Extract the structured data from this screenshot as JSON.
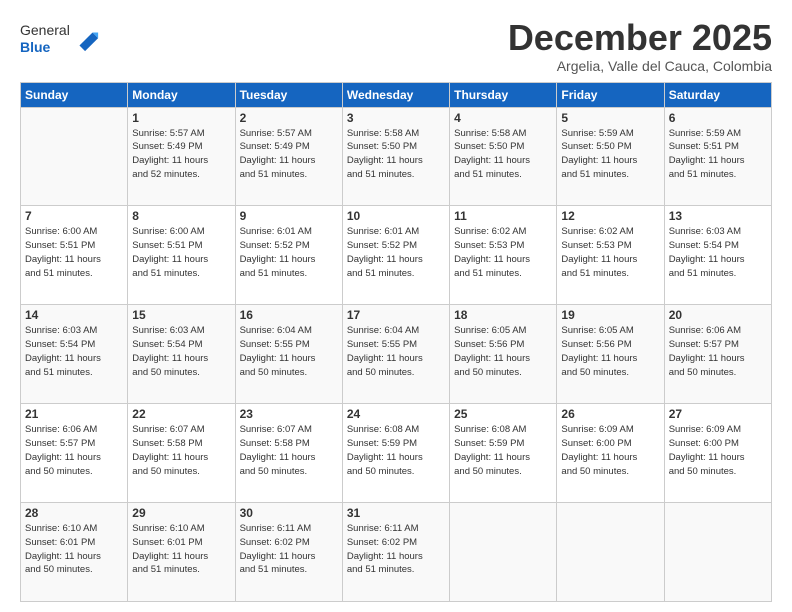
{
  "header": {
    "logo_general": "General",
    "logo_blue": "Blue",
    "month_title": "December 2025",
    "location": "Argelia, Valle del Cauca, Colombia"
  },
  "weekdays": [
    "Sunday",
    "Monday",
    "Tuesday",
    "Wednesday",
    "Thursday",
    "Friday",
    "Saturday"
  ],
  "weeks": [
    [
      {
        "day": "",
        "info": ""
      },
      {
        "day": "1",
        "info": "Sunrise: 5:57 AM\nSunset: 5:49 PM\nDaylight: 11 hours\nand 52 minutes."
      },
      {
        "day": "2",
        "info": "Sunrise: 5:57 AM\nSunset: 5:49 PM\nDaylight: 11 hours\nand 51 minutes."
      },
      {
        "day": "3",
        "info": "Sunrise: 5:58 AM\nSunset: 5:50 PM\nDaylight: 11 hours\nand 51 minutes."
      },
      {
        "day": "4",
        "info": "Sunrise: 5:58 AM\nSunset: 5:50 PM\nDaylight: 11 hours\nand 51 minutes."
      },
      {
        "day": "5",
        "info": "Sunrise: 5:59 AM\nSunset: 5:50 PM\nDaylight: 11 hours\nand 51 minutes."
      },
      {
        "day": "6",
        "info": "Sunrise: 5:59 AM\nSunset: 5:51 PM\nDaylight: 11 hours\nand 51 minutes."
      }
    ],
    [
      {
        "day": "7",
        "info": "Sunrise: 6:00 AM\nSunset: 5:51 PM\nDaylight: 11 hours\nand 51 minutes."
      },
      {
        "day": "8",
        "info": "Sunrise: 6:00 AM\nSunset: 5:51 PM\nDaylight: 11 hours\nand 51 minutes."
      },
      {
        "day": "9",
        "info": "Sunrise: 6:01 AM\nSunset: 5:52 PM\nDaylight: 11 hours\nand 51 minutes."
      },
      {
        "day": "10",
        "info": "Sunrise: 6:01 AM\nSunset: 5:52 PM\nDaylight: 11 hours\nand 51 minutes."
      },
      {
        "day": "11",
        "info": "Sunrise: 6:02 AM\nSunset: 5:53 PM\nDaylight: 11 hours\nand 51 minutes."
      },
      {
        "day": "12",
        "info": "Sunrise: 6:02 AM\nSunset: 5:53 PM\nDaylight: 11 hours\nand 51 minutes."
      },
      {
        "day": "13",
        "info": "Sunrise: 6:03 AM\nSunset: 5:54 PM\nDaylight: 11 hours\nand 51 minutes."
      }
    ],
    [
      {
        "day": "14",
        "info": "Sunrise: 6:03 AM\nSunset: 5:54 PM\nDaylight: 11 hours\nand 51 minutes."
      },
      {
        "day": "15",
        "info": "Sunrise: 6:03 AM\nSunset: 5:54 PM\nDaylight: 11 hours\nand 50 minutes."
      },
      {
        "day": "16",
        "info": "Sunrise: 6:04 AM\nSunset: 5:55 PM\nDaylight: 11 hours\nand 50 minutes."
      },
      {
        "day": "17",
        "info": "Sunrise: 6:04 AM\nSunset: 5:55 PM\nDaylight: 11 hours\nand 50 minutes."
      },
      {
        "day": "18",
        "info": "Sunrise: 6:05 AM\nSunset: 5:56 PM\nDaylight: 11 hours\nand 50 minutes."
      },
      {
        "day": "19",
        "info": "Sunrise: 6:05 AM\nSunset: 5:56 PM\nDaylight: 11 hours\nand 50 minutes."
      },
      {
        "day": "20",
        "info": "Sunrise: 6:06 AM\nSunset: 5:57 PM\nDaylight: 11 hours\nand 50 minutes."
      }
    ],
    [
      {
        "day": "21",
        "info": "Sunrise: 6:06 AM\nSunset: 5:57 PM\nDaylight: 11 hours\nand 50 minutes."
      },
      {
        "day": "22",
        "info": "Sunrise: 6:07 AM\nSunset: 5:58 PM\nDaylight: 11 hours\nand 50 minutes."
      },
      {
        "day": "23",
        "info": "Sunrise: 6:07 AM\nSunset: 5:58 PM\nDaylight: 11 hours\nand 50 minutes."
      },
      {
        "day": "24",
        "info": "Sunrise: 6:08 AM\nSunset: 5:59 PM\nDaylight: 11 hours\nand 50 minutes."
      },
      {
        "day": "25",
        "info": "Sunrise: 6:08 AM\nSunset: 5:59 PM\nDaylight: 11 hours\nand 50 minutes."
      },
      {
        "day": "26",
        "info": "Sunrise: 6:09 AM\nSunset: 6:00 PM\nDaylight: 11 hours\nand 50 minutes."
      },
      {
        "day": "27",
        "info": "Sunrise: 6:09 AM\nSunset: 6:00 PM\nDaylight: 11 hours\nand 50 minutes."
      }
    ],
    [
      {
        "day": "28",
        "info": "Sunrise: 6:10 AM\nSunset: 6:01 PM\nDaylight: 11 hours\nand 50 minutes."
      },
      {
        "day": "29",
        "info": "Sunrise: 6:10 AM\nSunset: 6:01 PM\nDaylight: 11 hours\nand 51 minutes."
      },
      {
        "day": "30",
        "info": "Sunrise: 6:11 AM\nSunset: 6:02 PM\nDaylight: 11 hours\nand 51 minutes."
      },
      {
        "day": "31",
        "info": "Sunrise: 6:11 AM\nSunset: 6:02 PM\nDaylight: 11 hours\nand 51 minutes."
      },
      {
        "day": "",
        "info": ""
      },
      {
        "day": "",
        "info": ""
      },
      {
        "day": "",
        "info": ""
      }
    ]
  ]
}
